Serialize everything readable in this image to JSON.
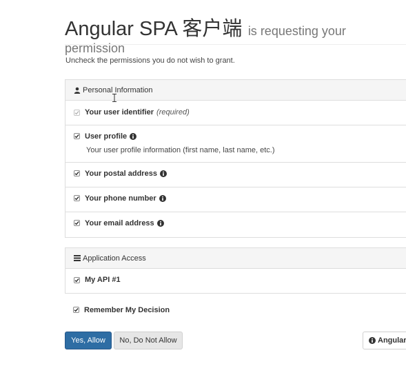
{
  "header": {
    "client_name": "Angular SPA 客户端",
    "subtitle": "is requesting your permission"
  },
  "instructions": "Uncheck the permissions you do not wish to grant.",
  "personal": {
    "heading": "Personal Information",
    "heading_icon": "user-icon",
    "scopes": [
      {
        "label": "Your user identifier",
        "note": "(required)",
        "checked": true,
        "disabled": true
      },
      {
        "label": "User profile",
        "description": "Your user profile information (first name, last name, etc.)",
        "checked": true,
        "info": true
      },
      {
        "label": "Your postal address",
        "checked": true,
        "info": true
      },
      {
        "label": "Your phone number",
        "checked": true,
        "info": true
      },
      {
        "label": "Your email address",
        "checked": true,
        "info": true
      }
    ]
  },
  "application": {
    "heading": "Application Access",
    "heading_icon": "list-icon",
    "scopes": [
      {
        "label": "My API #1",
        "checked": true
      }
    ]
  },
  "remember": {
    "label": "Remember My Decision",
    "checked": true
  },
  "buttons": {
    "allow": "Yes, Allow",
    "deny": "No, Do Not Allow",
    "client": "Angular"
  },
  "colors": {
    "primary": "#2e6da4",
    "panel_heading_bg": "#f5f5f5",
    "border": "#dddddd"
  }
}
